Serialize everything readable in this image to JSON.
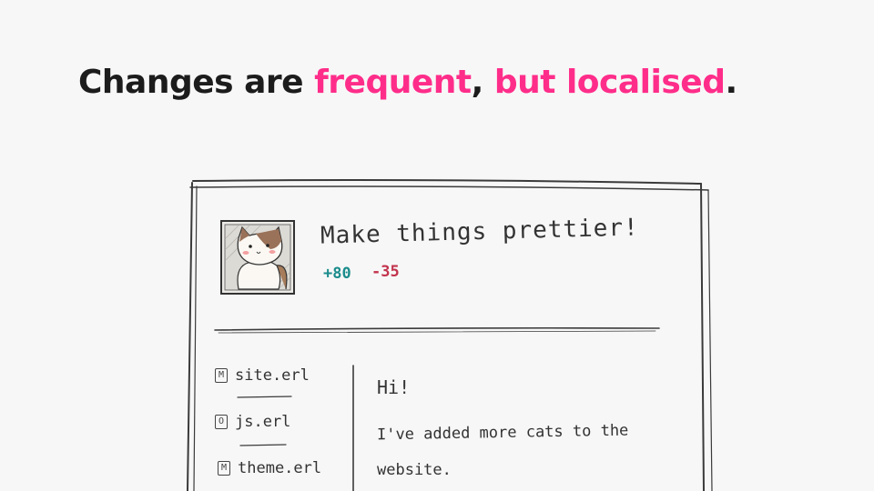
{
  "headline": {
    "part1": "Changes are ",
    "part2": "frequent",
    "part3": ", ",
    "part4": "but localised",
    "part5": "."
  },
  "colors": {
    "accent": "#ff2d8a",
    "additions": "#1c8c8c",
    "deletions": "#c2334d",
    "ink": "#333333"
  },
  "pull_request": {
    "avatar_icon": "cat-avatar",
    "title": "Make things prettier!",
    "additions": "+80",
    "deletions": "-35"
  },
  "files": [
    {
      "status": "M",
      "name": "site.erl"
    },
    {
      "status": "O",
      "name": "js.erl"
    },
    {
      "status": "M",
      "name": "theme.erl"
    }
  ],
  "message": {
    "greeting": "Hi!",
    "line1": "I've added more cats to the",
    "line2": "website."
  }
}
